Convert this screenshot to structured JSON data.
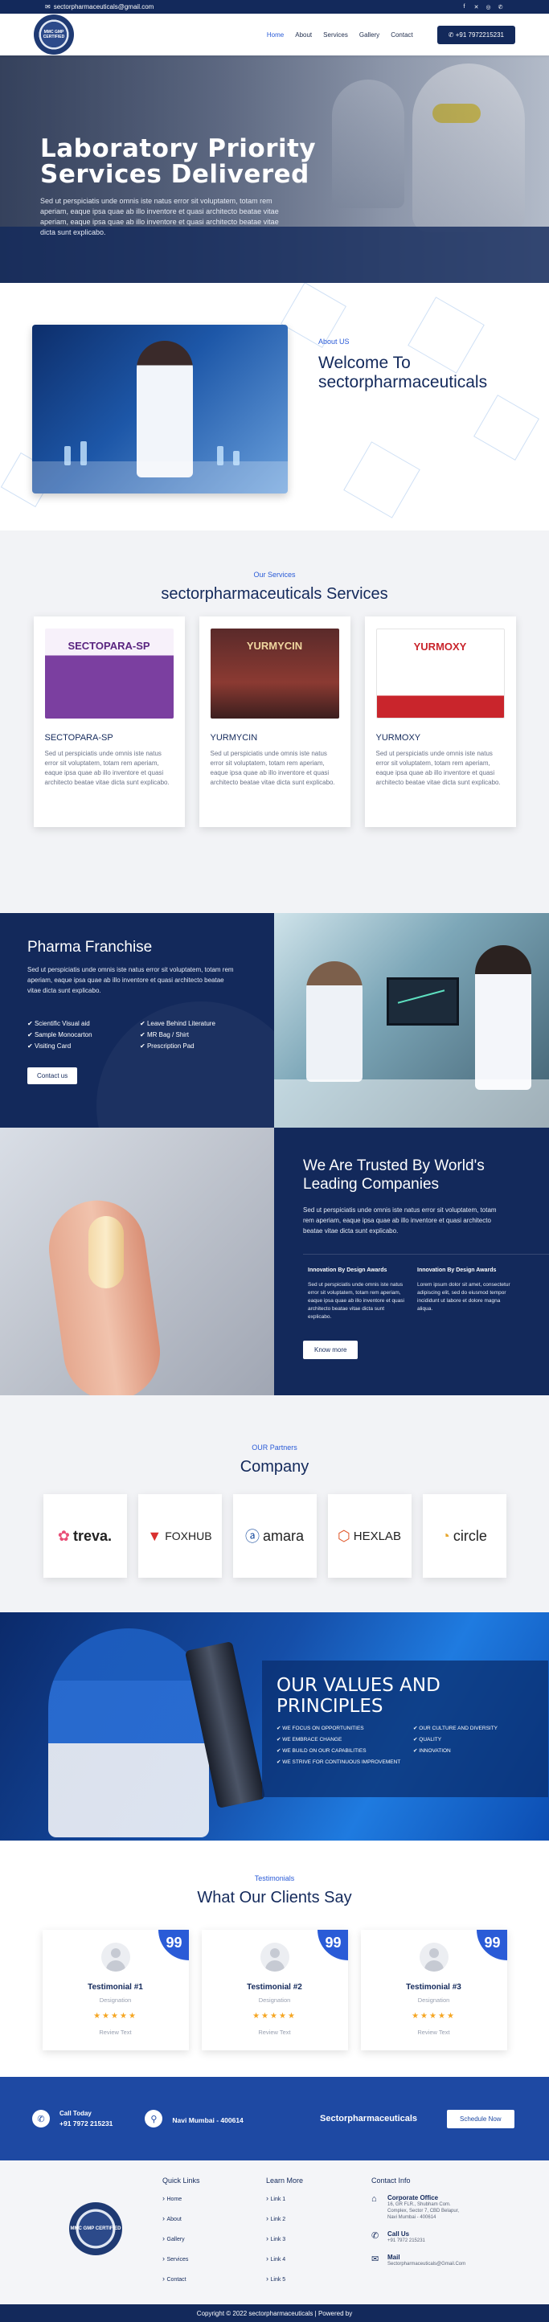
{
  "topbar": {
    "email": "sectorpharmaceuticals@gmail.com",
    "socials": [
      "facebook-icon",
      "twitter-icon",
      "instagram-icon",
      "whatsapp-icon"
    ]
  },
  "header": {
    "logo_text": "MMC GMP CERTIFIED",
    "nav": [
      "Home",
      "About",
      "Services",
      "Gallery",
      "Contact"
    ],
    "active_nav": "Home",
    "phone": "+91 7972215231"
  },
  "hero": {
    "title_line1": "Laboratory Priority",
    "title_line2": "Services Delivered",
    "text": "Sed ut perspiciatis unde omnis iste natus error sit voluptatem, totam rem aperiam, eaque ipsa quae ab illo inventore et quasi architecto beatae vitae aperiam, eaque ipsa quae ab illo inventore et quasi architecto beatae vitae dicta sunt explicabo."
  },
  "about": {
    "label": "About US",
    "title_line1": "Welcome To",
    "title_line2": "sectorpharmaceuticals"
  },
  "services": {
    "label": "Our Services",
    "title": "sectorpharmaceuticals Services",
    "cards": [
      {
        "name": "SECTOPARA-SP",
        "brand": "SECTOPARA-SP",
        "text": "Sed ut perspiciatis unde omnis iste natus error sit voluptatem, totam rem aperiam, eaque ipsa quae ab illo inventore et quasi architecto beatae vitae dicta sunt explicabo."
      },
      {
        "name": "YURMYCIN",
        "brand": "YURMYCIN",
        "text": "Sed ut perspiciatis unde omnis iste natus error sit voluptatem, totam rem aperiam, eaque ipsa quae ab illo inventore et quasi architecto beatae vitae dicta sunt explicabo."
      },
      {
        "name": "YURMOXY",
        "brand": "YURMOXY",
        "text": "Sed ut perspiciatis unde omnis iste natus error sit voluptatem, totam rem aperiam, eaque ipsa quae ab illo inventore et quasi architecto beatae vitae dicta sunt explicabo."
      }
    ]
  },
  "franchise": {
    "title": "Pharma Franchise",
    "text": "Sed ut perspiciatis unde omnis iste natus error sit voluptatem, totam rem aperiam, eaque ipsa quae ab illo inventore et quasi architecto beatae vitae dicta sunt explicabo.",
    "features": [
      "Scientific Visual aid",
      "Leave Behind Literature",
      "Sample Monocarton",
      "MR Bag / Shirt",
      "Visiting Card",
      "Prescription Pad"
    ],
    "button": "Contact us"
  },
  "trusted": {
    "title": "We Are Trusted By World's Leading Companies",
    "text": "Sed ut perspiciatis unde omnis iste natus error sit voluptatem, totam rem aperiam, eaque ipsa quae ab illo inventore et quasi architecto beatae vitae dicta sunt explicabo.",
    "awards": [
      {
        "title": "Innovation By Design Awards",
        "text": "Sed ut perspiciatis unde omnis iste natus error sit voluptatem, totam rem aperiam, eaque ipsa quae ab illo inventore et quasi architecto beatae vitae dicta sunt explicabo."
      },
      {
        "title": "Innovation By Design Awards",
        "text": "Lorem ipsum dolor sit amet, consectetur adipiscing elit, sed do eiusmod tempor incididunt ut labore et dolore magna aliqua."
      }
    ],
    "button": "Know more"
  },
  "partners": {
    "label": "OUR Partners",
    "title": "Company",
    "items": [
      "treva.",
      "FOXHUB",
      "amara",
      "HEXLAB",
      "circle"
    ]
  },
  "values": {
    "title_line1": "OUR VALUES AND",
    "title_line2": "PRINCIPLES",
    "items": [
      "WE FOCUS ON OPPORTUNITIES",
      "OUR CULTURE AND DIVERSITY",
      "WE EMBRACE CHANGE",
      "QUALITY",
      "WE BUILD ON OUR CAPABILITIES",
      "INNOVATION",
      "WE STRIVE FOR CONTINUOUS IMPROVEMENT"
    ]
  },
  "testimonials": {
    "label": "Testimonials",
    "title": "What Our Clients Say",
    "items": [
      {
        "name": "Testimonial #1",
        "designation": "Designation",
        "review": "Review Text"
      },
      {
        "name": "Testimonial #2",
        "designation": "Designation",
        "review": "Review Text"
      },
      {
        "name": "Testimonial #3",
        "designation": "Designation",
        "review": "Review Text"
      }
    ],
    "stars": "★★★★★",
    "quote_glyph": "99"
  },
  "cta": {
    "call_label": "Call Today",
    "phone": "+91 7972 215231",
    "location": "Navi Mumbai - 400614",
    "brand": "Sectorpharmaceuticals",
    "button": "Schedule Now"
  },
  "footer": {
    "logo_text": "MMC GMP CERTIFIED",
    "quick_links_title": "Quick Links",
    "quick_links": [
      "Home",
      "About",
      "Gallery",
      "Services",
      "Contact"
    ],
    "learn_more_title": "Learn More",
    "learn_more": [
      "Link 1",
      "Link 2",
      "Link 3",
      "Link 4",
      "Link 5"
    ],
    "contact_title": "Contact Info",
    "office_title": "Corporate Office",
    "office_text": "16, GR FLR., Shubham Com. Complex, Sector 7, CBD Belapur, Navi Mumbai - 400614",
    "call_title": "Call Us",
    "call_text": "+91 7972 215231",
    "mail_title": "Mail",
    "mail_text": "Sectorpharmaceuticals@Gmail.Com",
    "copyright": "Copyright © 2022 sectorpharmaceuticals | Powered by"
  },
  "colors": {
    "navy": "#13295b",
    "accent": "#2a5bd7",
    "cta_blue": "#1e49a3"
  }
}
